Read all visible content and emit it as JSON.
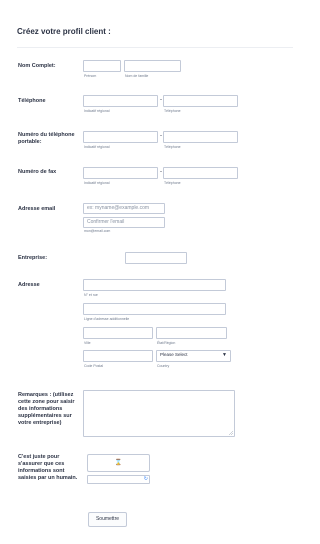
{
  "title": "Créez votre profil client :",
  "fields": {
    "name": {
      "label": "Nom Complet:",
      "first_sub": "Prénom",
      "last_sub": "Nom de famille"
    },
    "phone": {
      "label": "Téléphone",
      "area_sub": "Indicatif régional",
      "num_sub": "Téléphone",
      "dash": "-"
    },
    "mobile": {
      "label": "Numéro du téléphone portable:",
      "area_sub": "Indicatif régional",
      "num_sub": "Téléphone",
      "dash": "-"
    },
    "fax": {
      "label": "Numéro de fax",
      "area_sub": "Indicatif régional",
      "num_sub": "Téléphone",
      "dash": "-"
    },
    "email": {
      "label": "Adresse email",
      "placeholder": "ex: myname@example.com",
      "confirm_placeholder": "Confirmer l'email",
      "sub": "mon@email.com"
    },
    "company": {
      "label": "Entreprise:"
    },
    "address": {
      "label": "Adresse",
      "street_sub": "N° et rue",
      "line2_sub": "Ligne d'adresse additionnelle",
      "city_sub": "Ville",
      "state_sub": "État/Région",
      "zip_sub": "Code Postal",
      "country_sub": "Country",
      "country_value": "Please Select"
    },
    "remarks": {
      "label": "Remarques : (utilisez cette zone pour saisir des informations supplémentaires sur votre entreprise)"
    },
    "captcha": {
      "label": "C'est juste pour s'assurer que ces informations sont saisies par un humain."
    }
  },
  "submit_label": "Soumettre",
  "icons": {
    "chevron": "chevron-down-icon",
    "spinner": "loading-icon",
    "refresh": "refresh-icon",
    "resize": "resize-grip-icon"
  }
}
